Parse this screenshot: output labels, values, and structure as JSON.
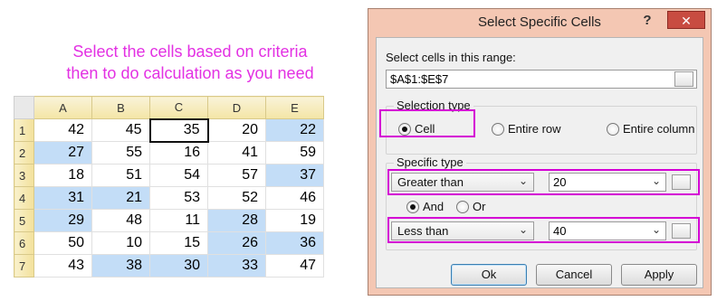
{
  "caption": {
    "line1": "Select the cells based on criteria",
    "line2": "then to do calculation as you need"
  },
  "spreadsheet": {
    "columns": [
      "A",
      "B",
      "C",
      "D",
      "E"
    ],
    "rows": [
      {
        "label": "1",
        "cells": [
          "42",
          "45",
          "35",
          "20",
          "22"
        ]
      },
      {
        "label": "2",
        "cells": [
          "27",
          "55",
          "16",
          "41",
          "59"
        ]
      },
      {
        "label": "3",
        "cells": [
          "18",
          "51",
          "54",
          "57",
          "37"
        ]
      },
      {
        "label": "4",
        "cells": [
          "31",
          "21",
          "53",
          "52",
          "46"
        ]
      },
      {
        "label": "5",
        "cells": [
          "29",
          "48",
          "11",
          "28",
          "19"
        ]
      },
      {
        "label": "6",
        "cells": [
          "50",
          "10",
          "15",
          "26",
          "36"
        ]
      },
      {
        "label": "7",
        "cells": [
          "43",
          "38",
          "30",
          "33",
          "47"
        ]
      }
    ],
    "selected": [
      [
        false,
        false,
        false,
        false,
        true
      ],
      [
        true,
        false,
        false,
        false,
        false
      ],
      [
        false,
        false,
        false,
        false,
        true
      ],
      [
        true,
        true,
        false,
        false,
        false
      ],
      [
        true,
        false,
        false,
        true,
        false
      ],
      [
        false,
        false,
        false,
        true,
        true
      ],
      [
        false,
        true,
        true,
        true,
        false
      ]
    ],
    "active_cell": "C1",
    "colors": {
      "selected_fill": "#c3ddf7",
      "header_fill": "#f4e5a6"
    }
  },
  "dialog": {
    "title": "Select Specific Cells",
    "help_label": "?",
    "close_label": "✕",
    "range_label": "Select cells in this range:",
    "range_value": "$A$1:$E$7",
    "selection_type": {
      "title": "Selection type",
      "options": [
        "Cell",
        "Entire row",
        "Entire column"
      ],
      "selected": "Cell"
    },
    "specific_type": {
      "title": "Specific type",
      "condition1": {
        "operator": "Greater than",
        "value": "20"
      },
      "logic_options": [
        "And",
        "Or"
      ],
      "logic_selected": "And",
      "condition2": {
        "operator": "Less than",
        "value": "40"
      }
    },
    "buttons": {
      "ok": "Ok",
      "cancel": "Cancel",
      "apply": "Apply"
    },
    "colors": {
      "title_bar": "#f4c7b3",
      "close_button": "#c84c41",
      "highlight": "#d400d4"
    }
  }
}
